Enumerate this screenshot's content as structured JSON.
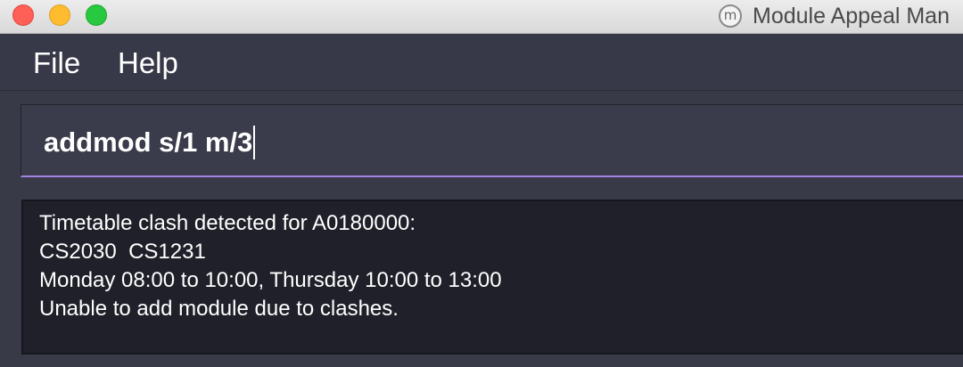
{
  "window": {
    "title": "Module Appeal Man",
    "app_icon_glyph": "m"
  },
  "menu": {
    "items": [
      {
        "label": "File"
      },
      {
        "label": "Help"
      }
    ]
  },
  "command": {
    "value": "addmod s/1 m/3",
    "accent_color": "#a384e0"
  },
  "result": {
    "lines": [
      "Timetable clash detected for A0180000:",
      "CS2030  CS1231",
      "Monday 08:00 to 10:00, Thursday 10:00 to 13:00",
      "Unable to add module due to clashes."
    ]
  },
  "colors": {
    "background": "#383a48",
    "result_background": "#1f2029",
    "text": "#ffffff",
    "close": "#fe5f57",
    "minimize": "#febc2e",
    "maximize": "#28c840"
  }
}
